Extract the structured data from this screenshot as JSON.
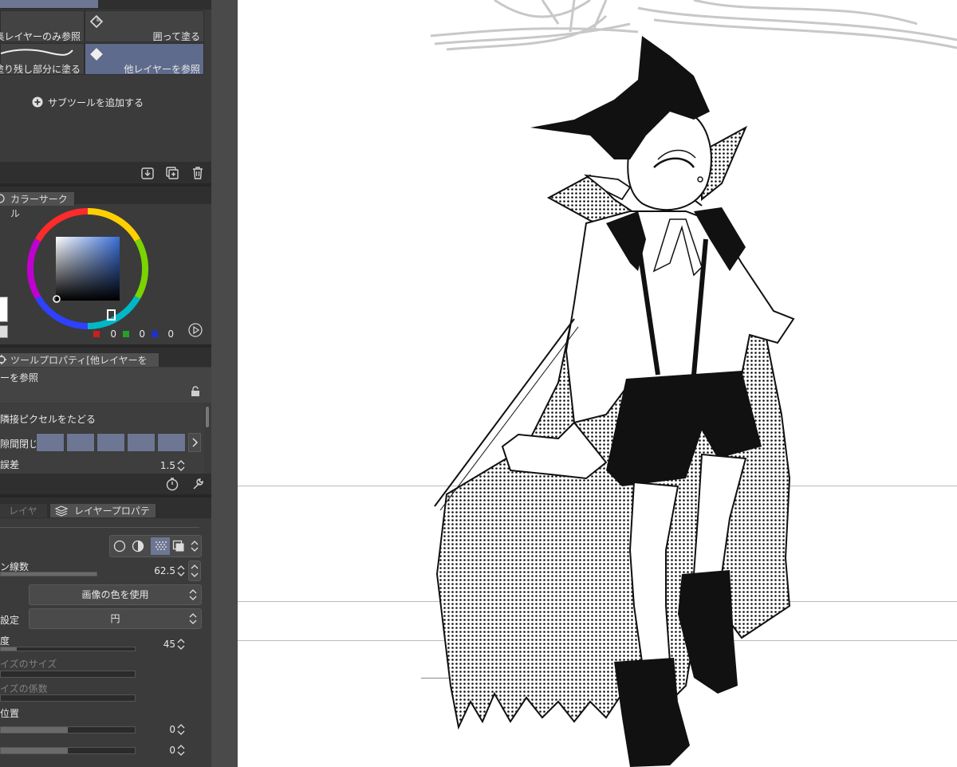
{
  "subtool_panel": {
    "items": [
      {
        "left_label": "集レイヤーのみ参照",
        "right_label": "囲って塗る"
      },
      {
        "left_label": "塗り残し部分に塗る",
        "right_label": "他レイヤーを参照"
      }
    ],
    "add_subtool_label": "サブツールを追加する"
  },
  "color_panel": {
    "tab_label": "カラーサークル",
    "rgb": {
      "r": "0",
      "g": "0",
      "b": "0"
    },
    "colors": {
      "hue_selected": "#3a6fd8",
      "main_color": "#ffffff"
    }
  },
  "tool_property": {
    "tab_label": "ツールプロパティ[他レイヤーを参照]",
    "tool_name": "ーを参照",
    "adjacent_pixels_label": "隣接ピクセルをたどる",
    "close_gap_label": "隙間閉じ",
    "tolerance_label": "誤差",
    "tolerance_value": "1.5"
  },
  "layer_property": {
    "tabs": [
      "レイヤー",
      "レイヤープロパティ"
    ],
    "screen_lines_label": "ン線数",
    "screen_lines_value": "62.5",
    "color_dropdown": "画像の色を使用",
    "setting_label": "設定",
    "shape_dropdown": "円",
    "angle_label": "度",
    "angle_value": "45",
    "noise_size_label": "イズのサイズ",
    "noise_factor_label": "イズの係数",
    "position_label": "位置",
    "pos_x_value": "0",
    "pos_y_value": "0"
  }
}
